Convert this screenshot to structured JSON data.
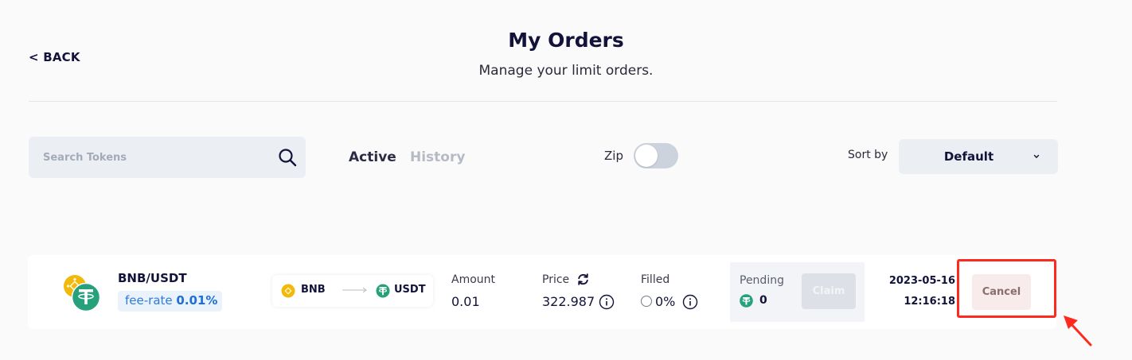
{
  "header": {
    "back_label": "< BACK",
    "title": "My Orders",
    "subtitle": "Manage your limit orders."
  },
  "search": {
    "placeholder": "Search Tokens",
    "value": ""
  },
  "tabs": [
    {
      "label": "Active",
      "selected": true
    },
    {
      "label": "History",
      "selected": false
    }
  ],
  "zip": {
    "label": "Zip",
    "enabled": false
  },
  "sort": {
    "label": "Sort by",
    "value": "Default"
  },
  "order": {
    "pair": "BNB/USDT",
    "fee_prefix": "fee-rate",
    "fee_value": "0.01%",
    "from_token": "BNB",
    "to_token": "USDT",
    "amount_label": "Amount",
    "amount_value": "0.01",
    "price_label": "Price",
    "price_value": "322.987",
    "filled_label": "Filled",
    "filled_value": "0%",
    "pending_label": "Pending",
    "pending_value": "0",
    "claim_label": "Claim",
    "date": "2023-05-16",
    "time": "12:16:18",
    "cancel_label": "Cancel"
  },
  "icons": {
    "bnb": "bnb-coin-icon",
    "usdt": "usdt-coin-icon",
    "search": "search-icon",
    "refresh": "refresh-icon",
    "info": "info-icon",
    "chevron": "chevron-down-icon",
    "annotation_arrow": "red-arrow-icon"
  },
  "colors": {
    "bnb": "#f0b90b",
    "usdt": "#26a17b",
    "fee_text": "#1e6fd9",
    "highlight": "#ff2a1f",
    "cancel_bg": "#f8ebeb"
  }
}
